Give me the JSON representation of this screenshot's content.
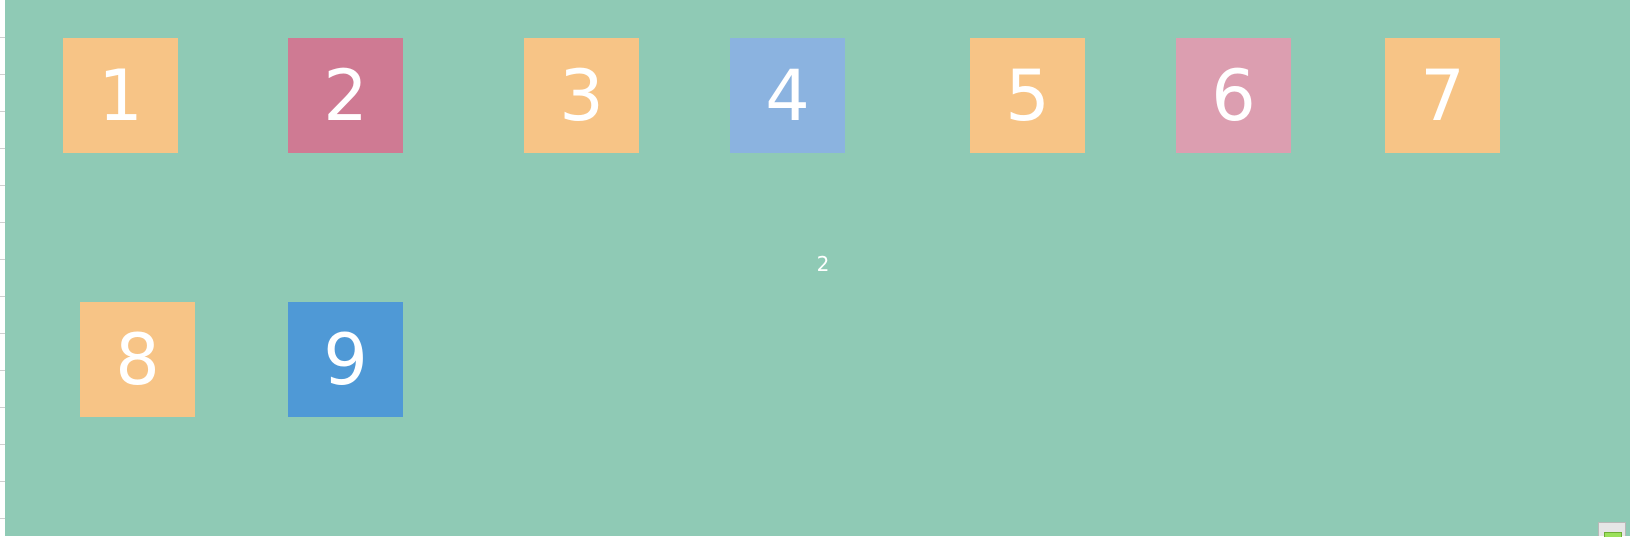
{
  "board": {
    "background_color": "#8fcab5",
    "center_label": "2",
    "tiles": [
      {
        "label": "1",
        "color": "#f7c486"
      },
      {
        "label": "2",
        "color": "#cf7a93"
      },
      {
        "label": "3",
        "color": "#f7c486"
      },
      {
        "label": "4",
        "color": "#8bb3e0"
      },
      {
        "label": "5",
        "color": "#f7c486"
      },
      {
        "label": "6",
        "color": "#dc9eb0"
      },
      {
        "label": "7",
        "color": "#f7c486"
      },
      {
        "label": "8",
        "color": "#f7c486"
      },
      {
        "label": "9",
        "color": "#4f99d6"
      }
    ]
  },
  "corner_widget": {
    "icon": "battery-icon",
    "color": "#9be05a"
  }
}
